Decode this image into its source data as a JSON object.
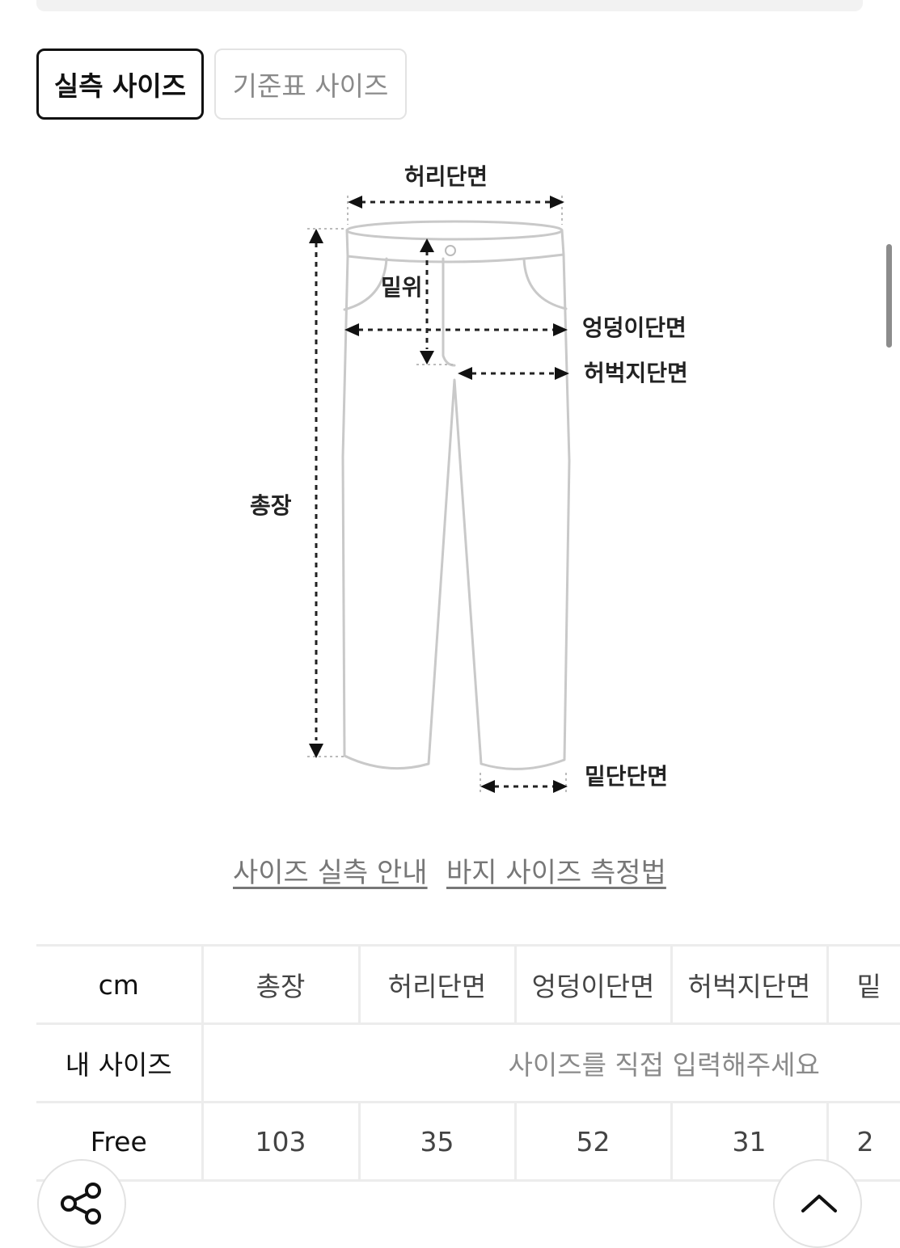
{
  "tabs": {
    "actual": "실측 사이즈",
    "standard": "기준표 사이즈"
  },
  "diagram": {
    "waist": "허리단면",
    "rise": "밑위",
    "hip": "엉덩이단면",
    "thigh": "허벅지단면",
    "length": "총장",
    "hem": "밑단단면"
  },
  "links": {
    "guide": "사이즈 실측 안내",
    "howto": "바지 사이즈 측정법"
  },
  "table": {
    "headers": [
      "cm",
      "총장",
      "허리단면",
      "엉덩이단면",
      "허벅지단면",
      "밑"
    ],
    "my_size_label": "내 사이즈",
    "my_size_placeholder": "사이즈를 직접 입력해주세요",
    "rows": [
      {
        "size": "Free",
        "values": [
          "103",
          "35",
          "52",
          "31",
          "2"
        ]
      }
    ]
  },
  "icons": {
    "share": "share-icon",
    "top": "chevron-up-icon"
  }
}
